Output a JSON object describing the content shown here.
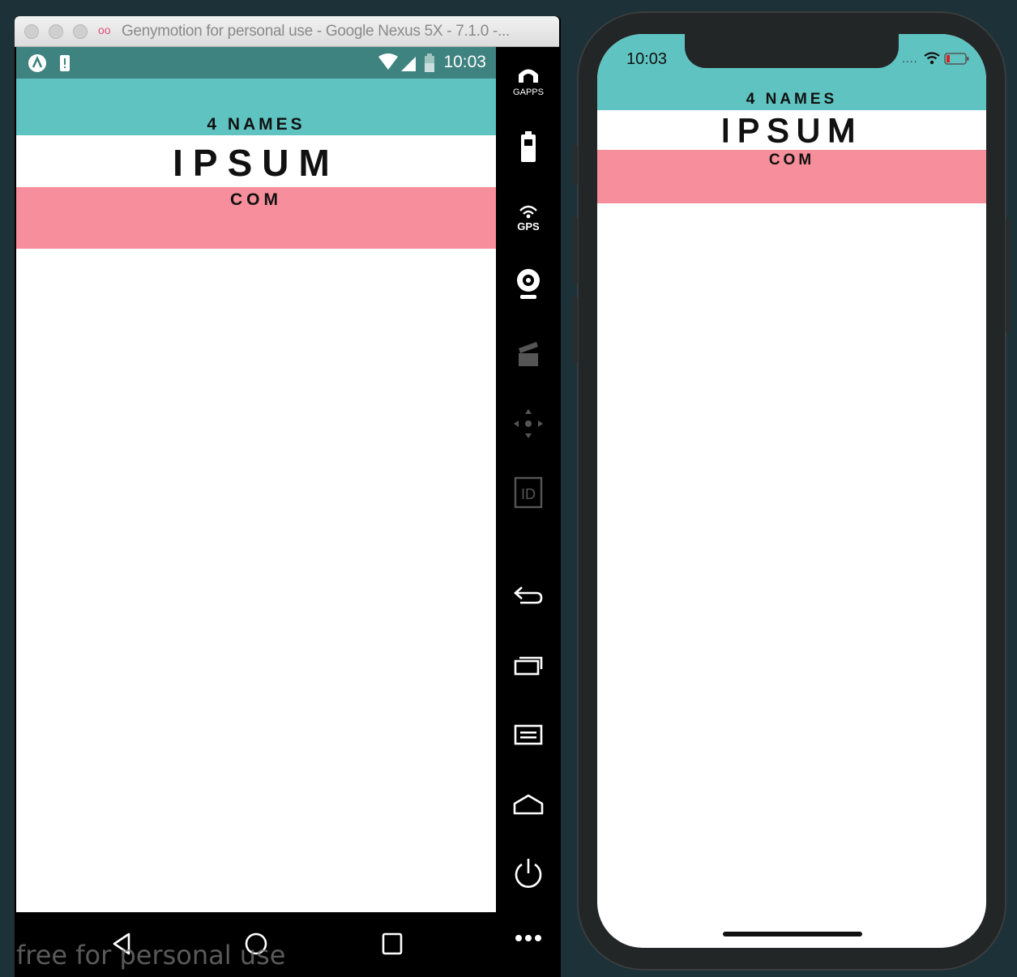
{
  "genymotion": {
    "window_title": "Genymotion for personal use - Google Nexus 5X - 7.1.0 -...",
    "status_time": "10:03",
    "toolbar": {
      "gapps_label": "GAPPS",
      "gps_label": "GPS",
      "id_label": "ID"
    },
    "watermark": "free for personal use"
  },
  "app": {
    "line1": "4 NAMES",
    "line2": "IPSUM",
    "line3": "COM",
    "colors": {
      "teal": "#5fc4c1",
      "pink": "#f78e9b",
      "white": "#ffffff"
    }
  },
  "iphone": {
    "status_time": "10:03",
    "signal_dots": "...."
  }
}
